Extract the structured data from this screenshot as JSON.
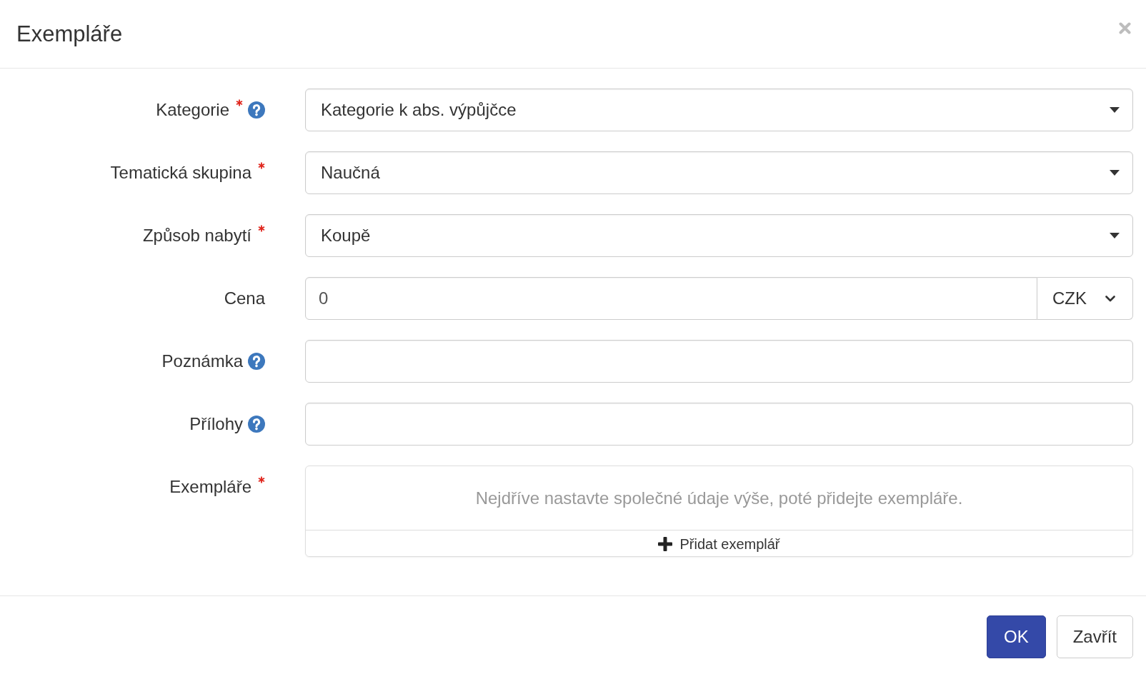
{
  "dialog": {
    "title": "Exempláře"
  },
  "form": {
    "fields": [
      {
        "kind": "select",
        "label": "Kategorie",
        "required": true,
        "help": true,
        "value": "Kategorie k abs. výpůjčce"
      },
      {
        "kind": "select",
        "label": "Tematická skupina",
        "required": true,
        "help": false,
        "value": "Naučná"
      },
      {
        "kind": "select",
        "label": "Způsob nabytí",
        "required": true,
        "help": false,
        "value": "Koupě"
      },
      {
        "kind": "money",
        "label": "Cena",
        "required": false,
        "help": false,
        "value": "0",
        "currency": "CZK"
      },
      {
        "kind": "text",
        "label": "Poznámka",
        "required": false,
        "help": true
      },
      {
        "kind": "text",
        "label": "Přílohy",
        "required": false,
        "help": true
      },
      {
        "kind": "items",
        "label": "Exempláře",
        "required": true,
        "help": false,
        "empty_message": "Nejdříve nastavte společné údaje výše, poté přidejte exempláře.",
        "add_label": "Přidat exemplář"
      }
    ]
  },
  "footer": {
    "buttons": [
      {
        "label": "OK",
        "kind": "primary"
      },
      {
        "label": "Zavřít",
        "kind": "secondary"
      }
    ]
  }
}
